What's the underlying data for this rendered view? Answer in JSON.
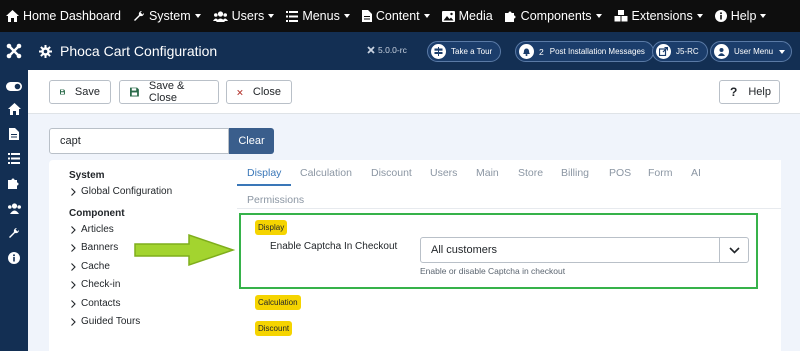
{
  "topmenu": [
    {
      "label": "Home Dashboard",
      "icon": "home-icon",
      "caret": false
    },
    {
      "label": "System",
      "icon": "wrench-icon",
      "caret": true
    },
    {
      "label": "Users",
      "icon": "users-icon",
      "caret": true
    },
    {
      "label": "Menus",
      "icon": "list-icon",
      "caret": true
    },
    {
      "label": "Content",
      "icon": "file-icon",
      "caret": true
    },
    {
      "label": "Media",
      "icon": "image-icon",
      "caret": false
    },
    {
      "label": "Components",
      "icon": "puzzle-icon",
      "caret": true
    },
    {
      "label": "Extensions",
      "icon": "cubes-icon",
      "caret": true
    },
    {
      "label": "Help",
      "icon": "info-icon",
      "caret": true
    }
  ],
  "header": {
    "title": "Phoca Cart Configuration",
    "version": "5.0.0-rc",
    "take_tour": "Take a Tour",
    "post_install_count": "2",
    "post_install": "Post Installation Messages",
    "site": "J5-RC",
    "user_menu": "User Menu"
  },
  "toolbar": {
    "save": "Save",
    "save_close": "Save & Close",
    "close": "Close",
    "help": "Help"
  },
  "search": {
    "value": "capt",
    "clear": "Clear"
  },
  "left": {
    "system_title": "System",
    "system_items": [
      "Global Configuration"
    ],
    "component_title": "Component",
    "component_items": [
      "Articles",
      "Banners",
      "Cache",
      "Check-in",
      "Contacts",
      "Guided Tours"
    ]
  },
  "tabs": [
    "Display",
    "Calculation",
    "Discount",
    "Users",
    "Main",
    "Store",
    "Billing",
    "POS",
    "Form",
    "AI",
    "Permissions"
  ],
  "content": {
    "badge_display": "Display",
    "field_label": "Enable Captcha In Checkout",
    "select_value": "All customers",
    "field_desc": "Enable or disable Captcha in checkout",
    "badge_calculation": "Calculation",
    "badge_discount": "Discount"
  },
  "colors": {
    "topbar": "#0e0e0e",
    "header": "#132f53",
    "accent": "#3a77b8",
    "highlight": "#36b24a",
    "badge": "#f5d400",
    "arrow": "#9fd02b"
  }
}
